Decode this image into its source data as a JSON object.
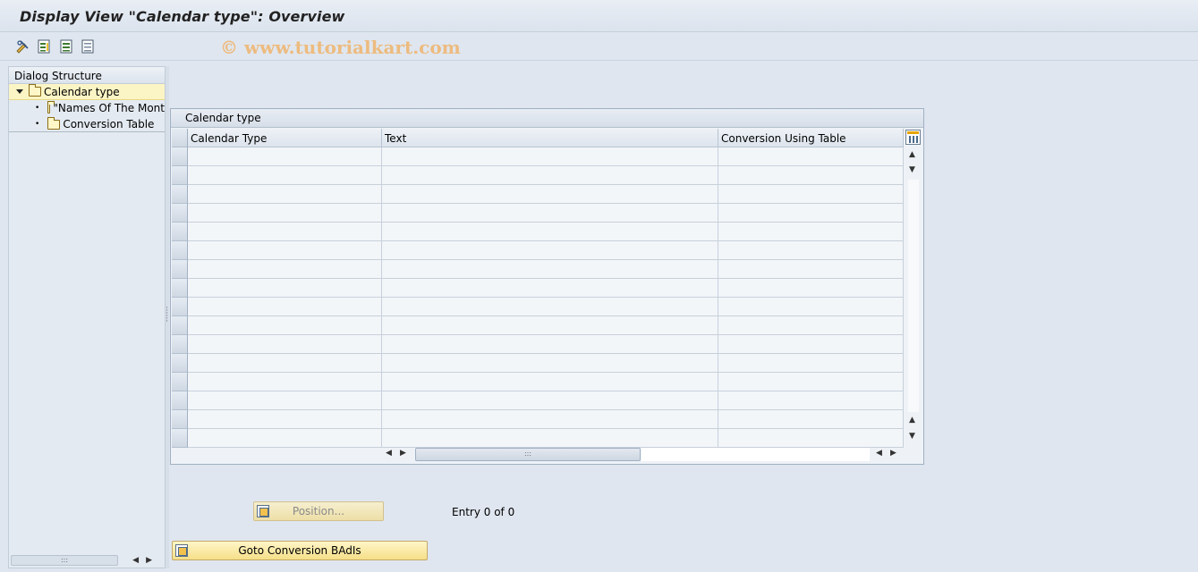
{
  "window": {
    "title": "Display View \"Calendar type\": Overview"
  },
  "watermark": "© www.tutorialkart.com",
  "toolbar": {
    "icons": [
      "change-display-icon",
      "details-icon",
      "select-all-icon",
      "deselect-icon"
    ]
  },
  "dialog_structure": {
    "header": "Dialog Structure",
    "items": [
      {
        "label": "Calendar type",
        "level": 0,
        "selected": true,
        "expanded": true
      },
      {
        "label": "\"Names Of The Mont",
        "level": 1,
        "selected": false
      },
      {
        "label": "Conversion Table",
        "level": 1,
        "selected": false
      }
    ]
  },
  "table": {
    "caption": "Calendar type",
    "columns": [
      "Calendar Type",
      "Text",
      "Conversion Using Table"
    ],
    "visible_rows": 16,
    "rows": []
  },
  "buttons": {
    "position": "Position...",
    "goto_conversion": "Goto Conversion BAdIs"
  },
  "status": {
    "entry": "Entry 0 of 0"
  }
}
